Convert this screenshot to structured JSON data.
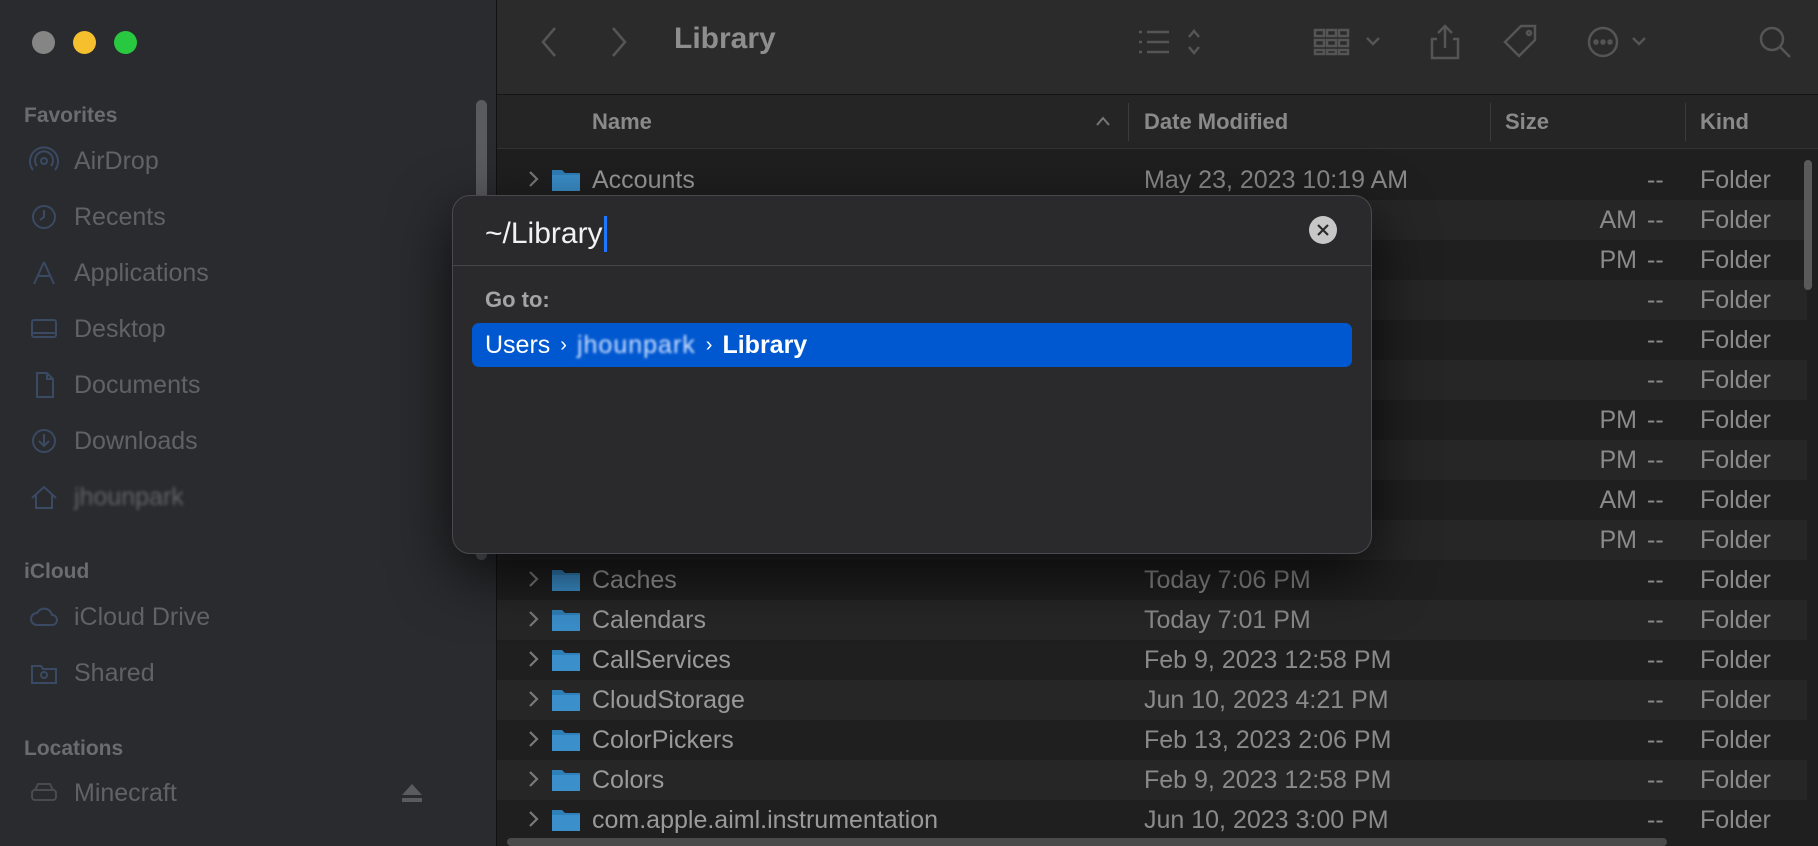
{
  "sidebar": {
    "sections": {
      "favorites": "Favorites",
      "icloud": "iCloud",
      "locations": "Locations"
    },
    "favorites": [
      {
        "label": "AirDrop",
        "icon": "airdrop-icon"
      },
      {
        "label": "Recents",
        "icon": "clock-icon"
      },
      {
        "label": "Applications",
        "icon": "applications-icon"
      },
      {
        "label": "Desktop",
        "icon": "desktop-icon"
      },
      {
        "label": "Documents",
        "icon": "document-icon"
      },
      {
        "label": "Downloads",
        "icon": "download-icon"
      },
      {
        "label": "jhounpark",
        "icon": "home-icon"
      }
    ],
    "icloud": [
      {
        "label": "iCloud Drive",
        "icon": "cloud-icon"
      },
      {
        "label": "Shared",
        "icon": "shared-folder-icon"
      }
    ],
    "locations": [
      {
        "label": "Minecraft",
        "icon": "disk-icon"
      }
    ]
  },
  "toolbar": {
    "title": "Library"
  },
  "columns": {
    "name": "Name",
    "date": "Date Modified",
    "size": "Size",
    "kind": "Kind"
  },
  "rows": [
    {
      "name": "Accounts",
      "date": "May 23, 2023 10:19 AM",
      "size": "--",
      "kind": "Folder"
    },
    {
      "name": "",
      "date": "",
      "size": "--",
      "kind": "Folder",
      "date_tail": "AM"
    },
    {
      "name": "",
      "date": "",
      "size": "--",
      "kind": "Folder",
      "date_tail": "PM"
    },
    {
      "name": "",
      "date": "",
      "size": "--",
      "kind": "Folder",
      "date_tail": ""
    },
    {
      "name": "",
      "date": "",
      "size": "--",
      "kind": "Folder",
      "date_tail": ""
    },
    {
      "name": "",
      "date": "",
      "size": "--",
      "kind": "Folder",
      "date_tail": ""
    },
    {
      "name": "",
      "date": "",
      "size": "--",
      "kind": "Folder",
      "date_tail": "PM"
    },
    {
      "name": "",
      "date": "",
      "size": "--",
      "kind": "Folder",
      "date_tail": "PM"
    },
    {
      "name": "",
      "date": "",
      "size": "--",
      "kind": "Folder",
      "date_tail": "AM"
    },
    {
      "name": "",
      "date": "",
      "size": "--",
      "kind": "Folder",
      "date_tail": "PM"
    },
    {
      "name": "Caches",
      "date": "Today 7:06 PM",
      "size": "--",
      "kind": "Folder"
    },
    {
      "name": "Calendars",
      "date": "Today 7:01 PM",
      "size": "--",
      "kind": "Folder"
    },
    {
      "name": "CallServices",
      "date": "Feb 9, 2023 12:58 PM",
      "size": "--",
      "kind": "Folder"
    },
    {
      "name": "CloudStorage",
      "date": "Jun 10, 2023 4:21 PM",
      "size": "--",
      "kind": "Folder"
    },
    {
      "name": "ColorPickers",
      "date": "Feb 13, 2023 2:06 PM",
      "size": "--",
      "kind": "Folder"
    },
    {
      "name": "Colors",
      "date": "Feb 9, 2023 12:58 PM",
      "size": "--",
      "kind": "Folder"
    },
    {
      "name": "com.apple.aiml.instrumentation",
      "date": "Jun 10, 2023 3:00 PM",
      "size": "--",
      "kind": "Folder"
    }
  ],
  "dialog": {
    "input_value": "~/Library",
    "goto_label": "Go to:",
    "result": {
      "part1": "Users",
      "part2": "jhounpark",
      "part3": "Library"
    }
  },
  "colors": {
    "accent": "#0058d0",
    "folder": "#2f7fb8"
  }
}
